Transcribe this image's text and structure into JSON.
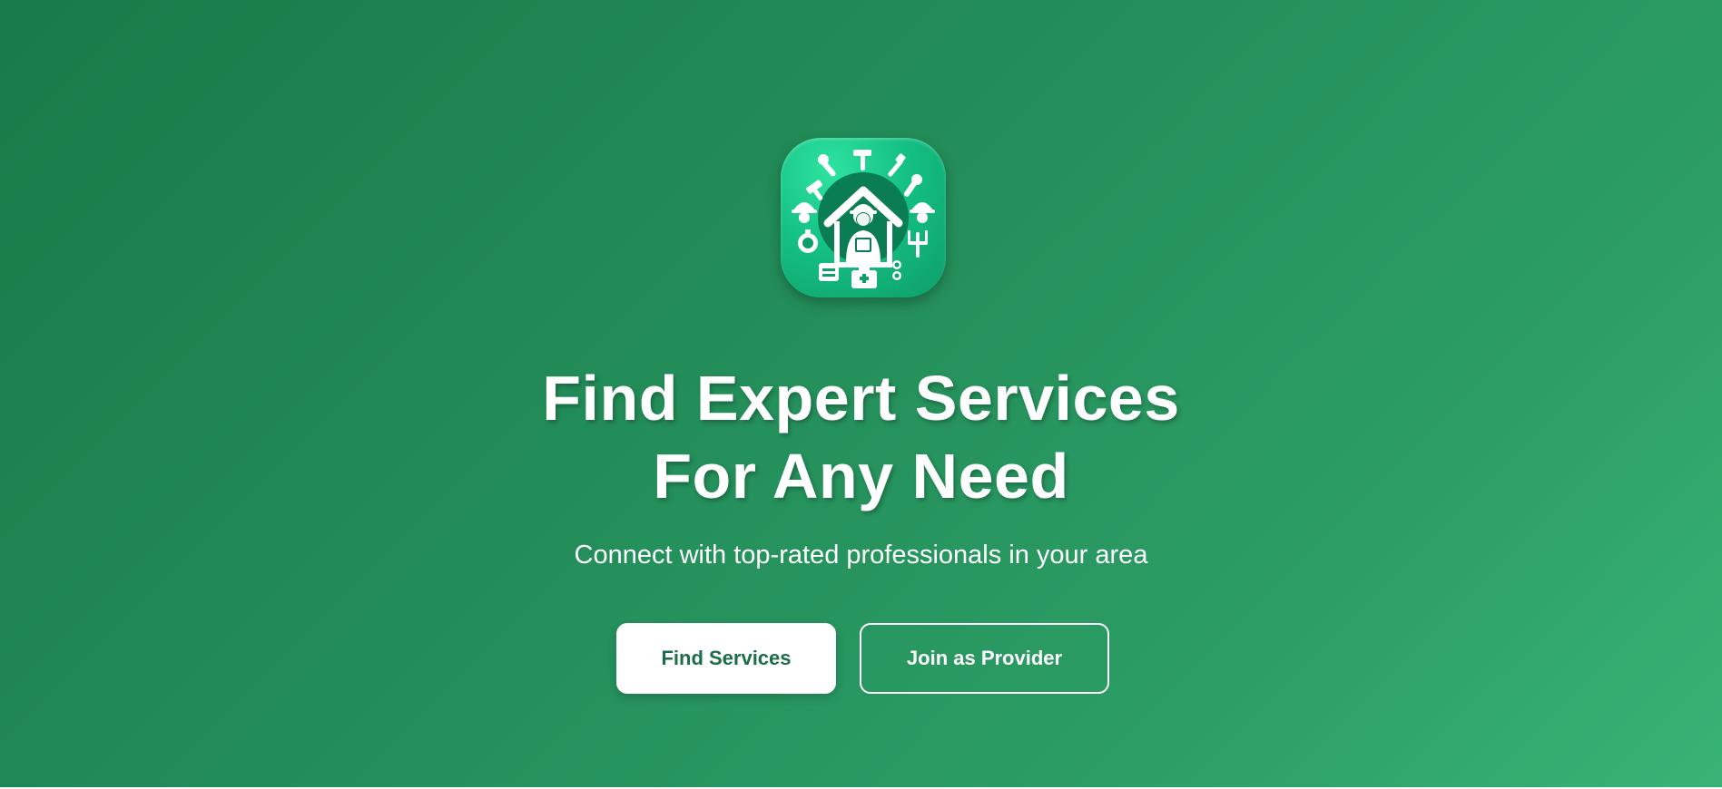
{
  "hero": {
    "logo_icon": "house-worker-tools-icon",
    "headline_line1": "Find Expert Services",
    "headline_line2": "For Any Need",
    "subtitle": "Connect with top-rated professionals in your area",
    "primary_button": "Find Services",
    "secondary_button": "Join as Provider"
  },
  "colors": {
    "gradient_start": "#187a48",
    "gradient_end": "#38b376",
    "primary_button_text": "#1b6e45",
    "logo_green": "#14c083"
  }
}
